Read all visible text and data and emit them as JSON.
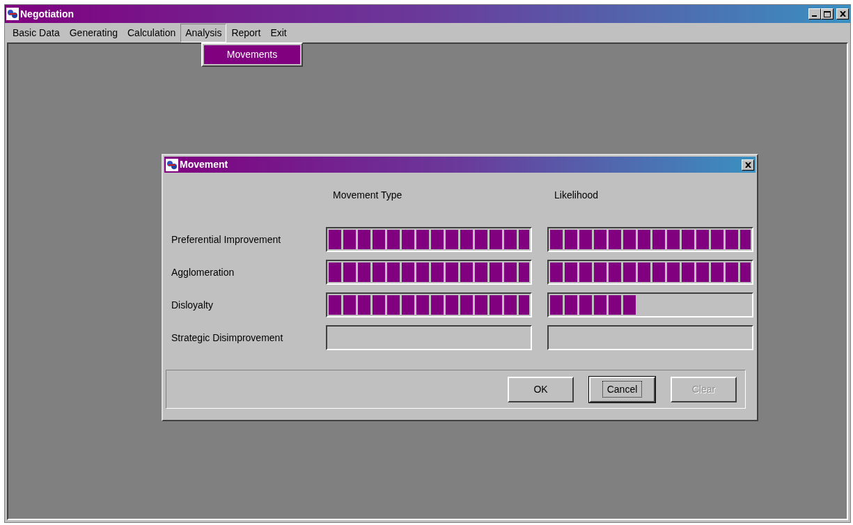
{
  "window": {
    "title": "Negotiation"
  },
  "menu": [
    {
      "label": "Basic Data",
      "selected": false
    },
    {
      "label": "Generating",
      "selected": false
    },
    {
      "label": "Calculation",
      "selected": false
    },
    {
      "label": "Analysis",
      "selected": true,
      "dropdown": [
        {
          "label": "Movements",
          "selected": true
        }
      ]
    },
    {
      "label": "Report",
      "selected": false
    },
    {
      "label": "Exit",
      "selected": false
    }
  ],
  "dialog": {
    "title": "Movement",
    "columns": [
      "Movement Type",
      "Likelihood"
    ],
    "rows": [
      {
        "label": "Preferential Improvement",
        "movement_type": {
          "level": 1
        },
        "likelihood": {
          "level": 1
        }
      },
      {
        "label": "Agglomeration",
        "movement_type": {
          "level": 1
        },
        "likelihood": {
          "level": 1
        }
      },
      {
        "label": "Disloyalty",
        "movement_type": {
          "level": 1
        },
        "likelihood": {
          "level": 0.43
        }
      },
      {
        "label": "Strategic Disimprovement",
        "movement_type": {
          "level": 0
        },
        "likelihood": {
          "level": 0
        }
      }
    ],
    "buttons": [
      {
        "label": "OK",
        "disabled": false,
        "focused": false
      },
      {
        "label": "Cancel",
        "disabled": false,
        "focused": true
      },
      {
        "label": "Clear",
        "disabled": true,
        "focused": false
      }
    ]
  }
}
